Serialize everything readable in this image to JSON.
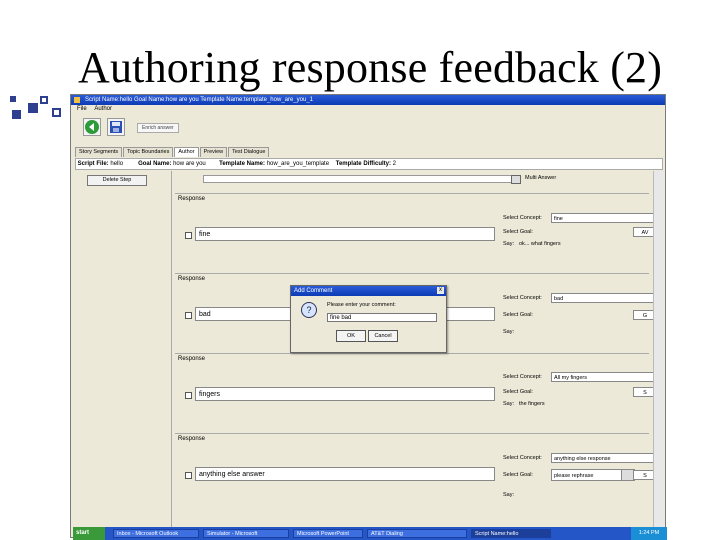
{
  "slide": {
    "title": "Authoring response feedback (2)"
  },
  "window": {
    "title": "Script Name:hello   Goal Name:how are you   Template Name:template_how_are_you_1",
    "menu": [
      "File",
      "Author"
    ],
    "toolbar_text": "Enrich answer"
  },
  "tabs": [
    "Story Segments",
    "Topic Boundaries",
    "Author",
    "Preview",
    "Test Dialogue"
  ],
  "infobar": {
    "script_label": "Script File:",
    "script_value": "hello",
    "goal_label": "Goal Name:",
    "goal_value": "how are you",
    "template_label": "Template Name:",
    "template_value": "how_are_you_template",
    "difficulty_label": "Template Difficulty:",
    "difficulty_value": "2"
  },
  "side": {
    "delete_step": "Delete Step"
  },
  "main": {
    "multi_answer": "Multi Answer"
  },
  "responses": [
    {
      "label": "Response",
      "text": "fine",
      "select_concept_label": "Select Concept:",
      "select_concept_value": "fine",
      "select_goal_label": "Select Goal:",
      "select_goal_value": "AV",
      "say_label": "Say:",
      "say_value": "ok... what fingers"
    },
    {
      "label": "Response",
      "text": "bad",
      "select_concept_label": "Select Concept:",
      "select_concept_value": "bad",
      "select_goal_label": "Select Goal:",
      "select_goal_value": "G",
      "say_label": "Say:",
      "say_value": ""
    },
    {
      "label": "Response",
      "text": "fingers",
      "select_concept_label": "Select Concept:",
      "select_concept_value": "All my fingers",
      "select_goal_label": "Select Goal:",
      "select_goal_value": "S",
      "say_label": "Say:",
      "say_value": "the fingers"
    },
    {
      "label": "Response",
      "text": "anything else answer",
      "select_concept_label": "Select Concept:",
      "select_concept_value": "anything else response",
      "select_goal_label": "Select Goal:",
      "select_goal_value": "please rephrase",
      "select_goal_right": "S",
      "say_label": "Say:",
      "say_value": ""
    }
  ],
  "dialog": {
    "title": "Add Comment",
    "close": "x",
    "icon": "?",
    "prompt": "Please enter your comment:",
    "input_value": "fine bad",
    "ok": "OK",
    "cancel": "Cancel"
  },
  "taskbar": {
    "start": "start",
    "tasks": [
      "Inbox - Microsoft Outlook",
      "Simulator - Microsoft",
      "Microsoft PowerPoint",
      "AT&T Dialing",
      "Script Name:hello"
    ],
    "clock": "1:24 PM"
  }
}
